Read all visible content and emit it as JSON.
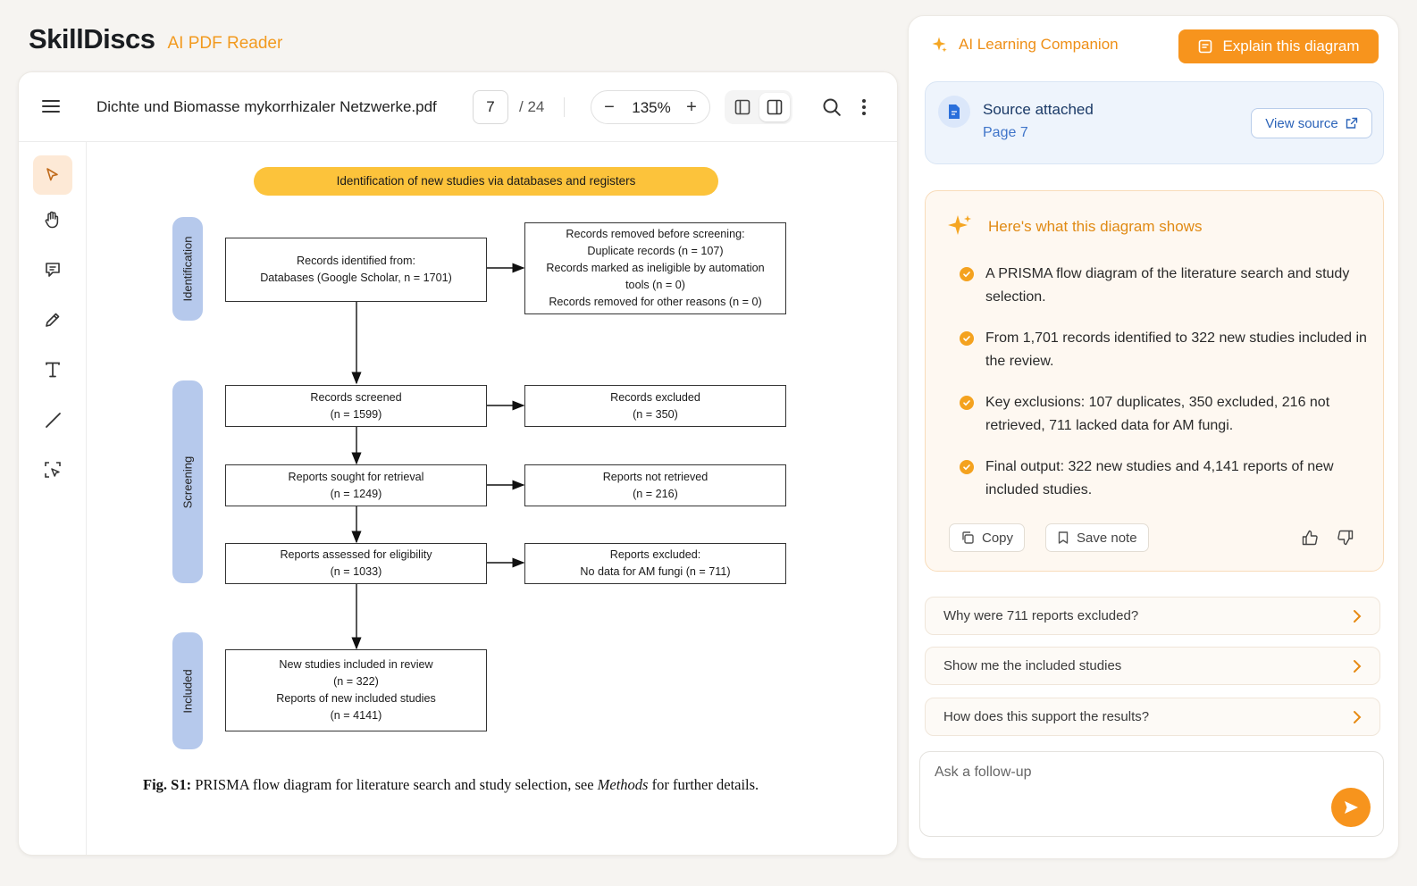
{
  "brand": {
    "name": "SkillDiscs",
    "product": "AI PDF Reader"
  },
  "viewer": {
    "filename": "Dichte und Biomasse mykorrhizaler Netzwerke.pdf",
    "page": "7",
    "total_pages": "/ 24",
    "zoom": "135%",
    "zoom_minus": "−",
    "zoom_plus": "+",
    "tools": [
      "select-tool",
      "hand-tool",
      "comment-tool",
      "pen-tool",
      "text-tool",
      "line-tool",
      "area-select-tool"
    ]
  },
  "diagram": {
    "band": "Identification of new studies via databases and registers",
    "phases": {
      "identification": "Identification",
      "screening": "Screening",
      "included": "Included"
    },
    "records_identified": [
      "Records identified from:",
      "Databases (Google Scholar, n = 1701)"
    ],
    "records_removed": [
      "Records removed before screening:",
      "Duplicate records (n = 107)",
      "Records marked as ineligible by automation",
      "tools (n = 0)",
      "Records removed for other reasons (n = 0)"
    ],
    "records_screened": [
      "Records screened",
      "(n = 1599)"
    ],
    "records_excluded": [
      "Records excluded",
      "(n = 350)"
    ],
    "reports_sought": [
      "Reports sought for retrieval",
      "(n = 1249)"
    ],
    "reports_not_retrieved": [
      "Reports not retrieved",
      "(n = 216)"
    ],
    "reports_assessed": [
      "Reports assessed for eligibility",
      "(n = 1033)"
    ],
    "reports_excluded": [
      "Reports excluded:",
      "No data for AM fungi (n = 711)"
    ],
    "included": [
      "New studies included in review",
      "(n = 322)",
      "Reports of new included studies",
      "(n = 4141)"
    ],
    "caption_label": "Fig. S1:",
    "caption_text": " PRISMA flow diagram for literature search and study selection, see ",
    "caption_italic": "Methods",
    "caption_end": " for further details."
  },
  "panel": {
    "title": "AI Learning Companion",
    "explain_button": "Explain this diagram",
    "source": {
      "title": "Source attached",
      "page": "Page 7",
      "view_button": "View source"
    },
    "answer": {
      "heading": "Here's what this diagram shows",
      "bullets": [
        "A PRISMA flow diagram of the literature search and study selection.",
        "From 1,701 records identified to 322 new studies included in the review.",
        "Key exclusions: 107 duplicates, 350 excluded, 216 not retrieved, 711 lacked data for AM fungi.",
        "Final output: 322 new studies and 4,141 reports of new included studies."
      ],
      "copy": "Copy",
      "save_note": "Save note"
    },
    "suggestions": [
      "Why were 711 reports excluded?",
      "Show me the included studies",
      "How does this support the results?"
    ],
    "followup_placeholder": "Ask a follow-up"
  },
  "colors": {
    "accent": "#f7941d",
    "band": "#fcc33b",
    "phase": "#b6c9ec",
    "source_bg": "#eef4fc"
  }
}
